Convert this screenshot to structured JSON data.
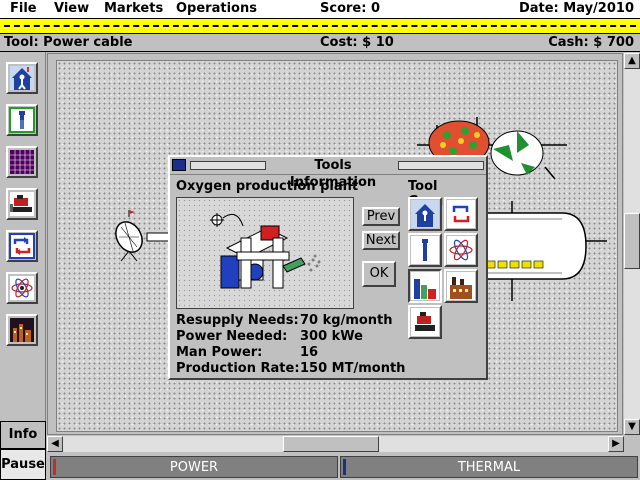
{
  "menu": {
    "items": [
      {
        "label": "File"
      },
      {
        "label": "View"
      },
      {
        "label": "Markets"
      },
      {
        "label": "Operations"
      }
    ],
    "score": "Score: 0",
    "date": "Date: May/2010"
  },
  "status": {
    "tool": "Tool: Power cable",
    "cost": "Cost: $ 10",
    "cash": "Cash: $ 700"
  },
  "toolbar": {
    "icons": [
      "habitat-icon",
      "probe-icon",
      "greenhouse-icon",
      "bulldozer-icon",
      "recycle-icon",
      "reactor-icon",
      "factory-icon"
    ],
    "info_label": "Info",
    "pause_label": "Pause"
  },
  "dialog": {
    "title": "Tools Information",
    "plant_name": "Oxygen production plant",
    "tool_group_label": "Tool Group",
    "prev_label": "Prev",
    "next_label": "Next",
    "ok_label": "OK",
    "stats": [
      {
        "label": "Resupply Needs:",
        "value": "70 kg/month"
      },
      {
        "label": "Power Needed:",
        "value": "300 kWe"
      },
      {
        "label": "Man Power:",
        "value": "16"
      },
      {
        "label": "Production Rate:",
        "value": "150 MT/month"
      }
    ],
    "group_icons": [
      "habitat-icon",
      "recycle-icon",
      "probe-icon",
      "reactor-icon",
      "greenhouse-icon",
      "factory-icon",
      "bulldozer-icon"
    ]
  },
  "meters": {
    "power_label": "POWER",
    "thermal_label": "THERMAL"
  },
  "colors": {
    "menu_bg": "#ffffff",
    "marquee": "#ffff00",
    "meter_bg": "#808080",
    "power_mark": "#c03020",
    "thermal_mark": "#1a2f8a"
  }
}
